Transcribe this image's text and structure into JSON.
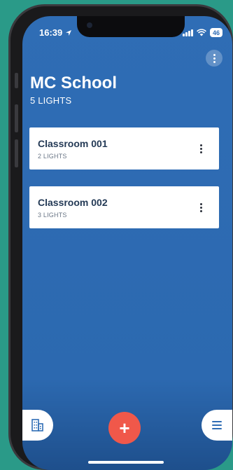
{
  "status_bar": {
    "time": "16:39",
    "battery": "46"
  },
  "header": {
    "title": "MC School",
    "subtitle": "5 LIGHTS"
  },
  "rooms": [
    {
      "name": "Classroom 001",
      "count": "2 LIGHTS"
    },
    {
      "name": "Classroom 002",
      "count": "3 LIGHTS"
    }
  ],
  "bottom_bar": {
    "add_label": "+"
  },
  "colors": {
    "background": "#2a9a88",
    "screen_blue": "#2f6db5",
    "accent_red": "#f0584a",
    "card_title": "#243a56"
  },
  "icons": {
    "location": "location-arrow-icon",
    "signal": "cellular-signal-icon",
    "wifi": "wifi-icon",
    "more": "more-vertical-icon",
    "building": "building-icon",
    "menu": "hamburger-menu-icon"
  }
}
